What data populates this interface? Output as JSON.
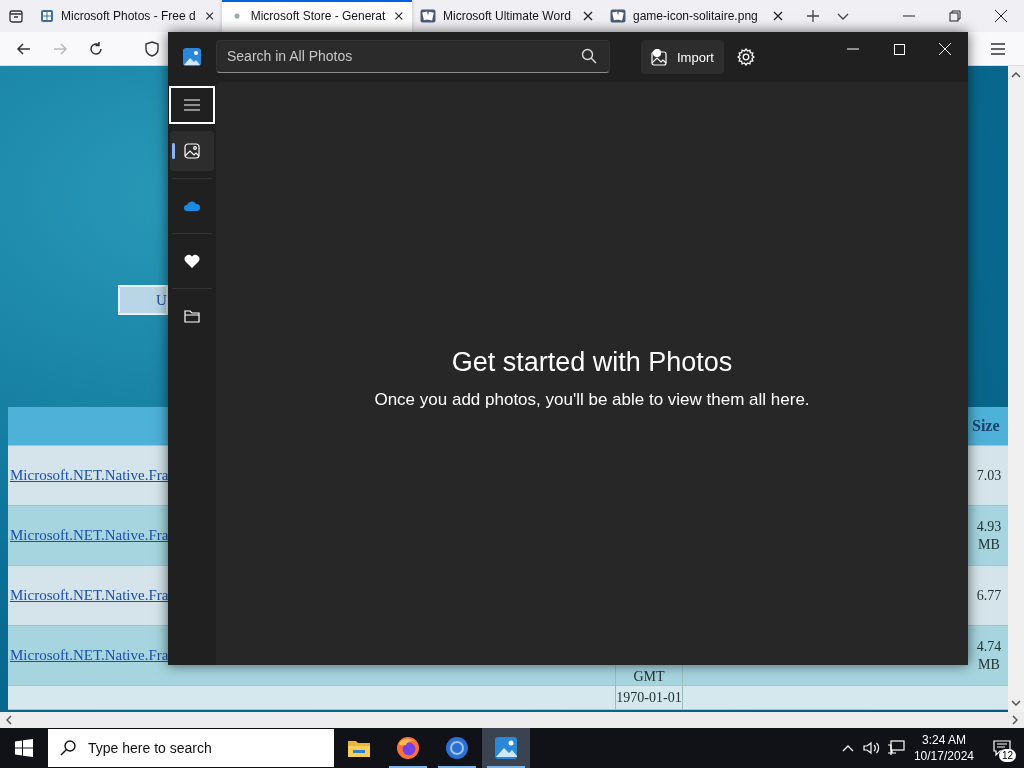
{
  "browser": {
    "tabs": [
      {
        "kind": "store",
        "title": "Microsoft Photos - Free d",
        "selected": false
      },
      {
        "kind": "dot",
        "title": "Microsoft Store - Generat",
        "selected": true
      },
      {
        "kind": "cards",
        "title": "Microsoft Ultimate Word",
        "selected": false
      },
      {
        "kind": "cards",
        "title": "game-icon-solitaire.png",
        "selected": false
      }
    ],
    "nav_buttons": [
      {
        "kind": "back",
        "disabled": false
      },
      {
        "kind": "forward",
        "disabled": true
      },
      {
        "kind": "reload",
        "disabled": false
      }
    ]
  },
  "page": {
    "button": "U",
    "size_header": "Size",
    "rows": [
      {
        "link": "Microsoft.NET.Native.Fra",
        "size": "7.03"
      },
      {
        "link": "Microsoft.NET.Native.Fra",
        "size": "4.93 MB"
      },
      {
        "link": "Microsoft.NET.Native.Fra",
        "size": "6.77"
      },
      {
        "link": "Microsoft.NET.Native.Fra",
        "size": "4.74 MB",
        "date_part": "GMT"
      }
    ],
    "last_row_date": "1970-01-01"
  },
  "photos_window": {
    "search": {
      "placeholder": "Search in All Photos"
    },
    "import": "Import",
    "nav": [
      {
        "kind": "menu",
        "selected": false
      },
      {
        "kind": "photos",
        "selected": true
      },
      {
        "kind": "cloud",
        "selected": false
      },
      {
        "kind": "favorites",
        "selected": false
      },
      {
        "kind": "folders",
        "selected": false
      }
    ],
    "heading": "Get started with Photos",
    "message": "Once you add photos, you'll be able to view them all here."
  },
  "taskbar": {
    "search": {
      "placeholder": "Type here to search"
    },
    "apps": [
      {
        "kind": "explorer",
        "running": false,
        "selected": false
      },
      {
        "kind": "firefox",
        "running": true,
        "selected": false
      },
      {
        "kind": "chrome",
        "running": true,
        "selected": false
      },
      {
        "kind": "photos",
        "running": true,
        "selected": true
      }
    ],
    "time": "3:24 AM",
    "date": "10/17/2024",
    "notifications": "12"
  }
}
